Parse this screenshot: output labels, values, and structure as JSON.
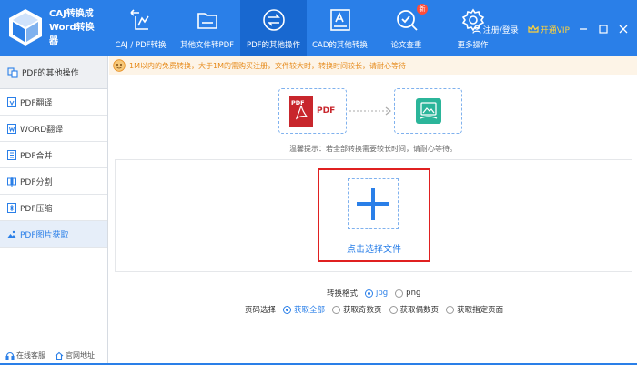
{
  "app": {
    "title_line1": "CAJ转换成",
    "title_line2": "Word转换",
    "title_line3": "器"
  },
  "nav": [
    {
      "label": "CAJ / PDF转换",
      "icon": "convert-icon"
    },
    {
      "label": "其他文件转PDF",
      "icon": "folder-icon"
    },
    {
      "label": "PDF的其他操作",
      "icon": "swap-icon"
    },
    {
      "label": "CAD的其他转换",
      "icon": "cad-icon"
    },
    {
      "label": "论文查重",
      "icon": "search-check-icon",
      "badge": "新"
    },
    {
      "label": "更多操作",
      "icon": "gear-icon"
    }
  ],
  "header_right": {
    "login": "注册/登录",
    "vip": "开通VIP"
  },
  "sidebar": {
    "header": "PDF的其他操作",
    "items": [
      {
        "label": "PDF翻译"
      },
      {
        "label": "WORD翻译"
      },
      {
        "label": "PDF合并"
      },
      {
        "label": "PDF分割"
      },
      {
        "label": "PDF压缩"
      },
      {
        "label": "PDF图片获取"
      }
    ],
    "footer": {
      "service": "在线客服",
      "website": "官网地址"
    }
  },
  "notice": "1M以内的免费转换，大于1M的需购买注册，文件较大时，转换时间较长，请耐心等待",
  "flow": {
    "pdf_tag": "PDF",
    "pdf_text": "PDF"
  },
  "tip": "温馨提示：若全部转换需要较长时间，请耐心等待。",
  "select": {
    "label": "点击选择文件"
  },
  "format": {
    "label": "转换格式",
    "options": [
      "jpg",
      "png"
    ],
    "selected": "jpg"
  },
  "pages": {
    "label": "页码选择",
    "options": [
      "获取全部",
      "获取奇数页",
      "获取偶数页",
      "获取指定页面"
    ],
    "selected": "获取全部"
  },
  "colors": {
    "header": "#2a7fe8",
    "active_nav": "#1868d0",
    "accent": "#2a7fe8",
    "highlight": "#e02020",
    "notice_text": "#e68a1a"
  }
}
